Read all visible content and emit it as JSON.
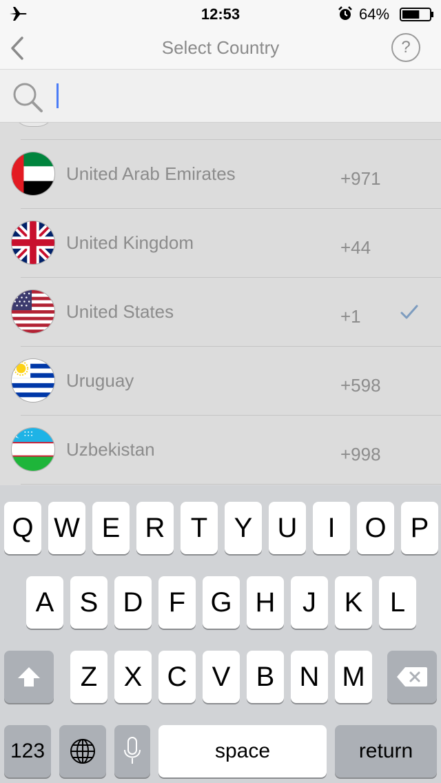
{
  "status_bar": {
    "time": "12:53",
    "battery_percent": "64%",
    "battery_level": 0.64
  },
  "nav": {
    "title": "Select Country",
    "help_label": "?"
  },
  "search": {
    "value": "",
    "placeholder": ""
  },
  "countries": [
    {
      "name": "United Arab Emirates",
      "code": "+971",
      "flag": "uae-flag",
      "selected": false
    },
    {
      "name": "United Kingdom",
      "code": "+44",
      "flag": "uk-flag",
      "selected": false
    },
    {
      "name": "United States",
      "code": "+1",
      "flag": "us-flag",
      "selected": true
    },
    {
      "name": "Uruguay",
      "code": "+598",
      "flag": "uruguay-flag",
      "selected": false
    },
    {
      "name": "Uzbekistan",
      "code": "+998",
      "flag": "uzbekistan-flag",
      "selected": false
    }
  ],
  "keyboard": {
    "row1": [
      "Q",
      "W",
      "E",
      "R",
      "T",
      "Y",
      "U",
      "I",
      "O",
      "P"
    ],
    "row2": [
      "A",
      "S",
      "D",
      "F",
      "G",
      "H",
      "J",
      "K",
      "L"
    ],
    "row3": [
      "Z",
      "X",
      "C",
      "V",
      "B",
      "N",
      "M"
    ],
    "numbers_label": "123",
    "space_label": "space",
    "return_label": "return"
  },
  "colors": {
    "accent": "#4a7cf7",
    "check": "#7d9cbf",
    "keyboard_bg": "#d1d3d6"
  }
}
